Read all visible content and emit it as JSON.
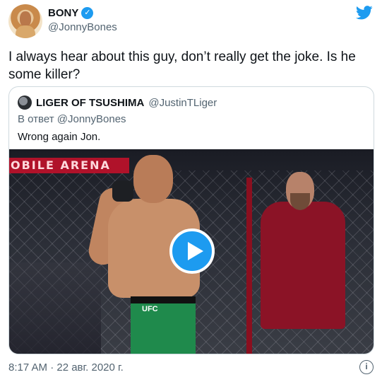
{
  "author": {
    "display_name": "BONY",
    "handle": "@JonnyBones",
    "verified_icon": "✓"
  },
  "tweet": {
    "text": "I always hear about this guy, don’t really get the joke. Is he some killer?",
    "timestamp": "8:17 AM · 22 авг. 2020 г."
  },
  "quoted_tweet": {
    "display_name": "LIGER OF TSUSHIMA",
    "handle": "@JustinTLiger",
    "reply_prefix": "В ответ",
    "reply_to": "@JonnyBones",
    "text": "Wrong again Jon.",
    "media": {
      "banner_text": "OBILE ARENA",
      "shorts_text": "UFC"
    }
  },
  "icons": {
    "twitter": "twitter-bird-icon",
    "play": "play-icon",
    "info": "info-icon",
    "info_glyph": "i"
  },
  "colors": {
    "accent": "#1d9bf0",
    "text": "#0f1419",
    "secondary": "#536471",
    "border": "#cfd9de"
  }
}
